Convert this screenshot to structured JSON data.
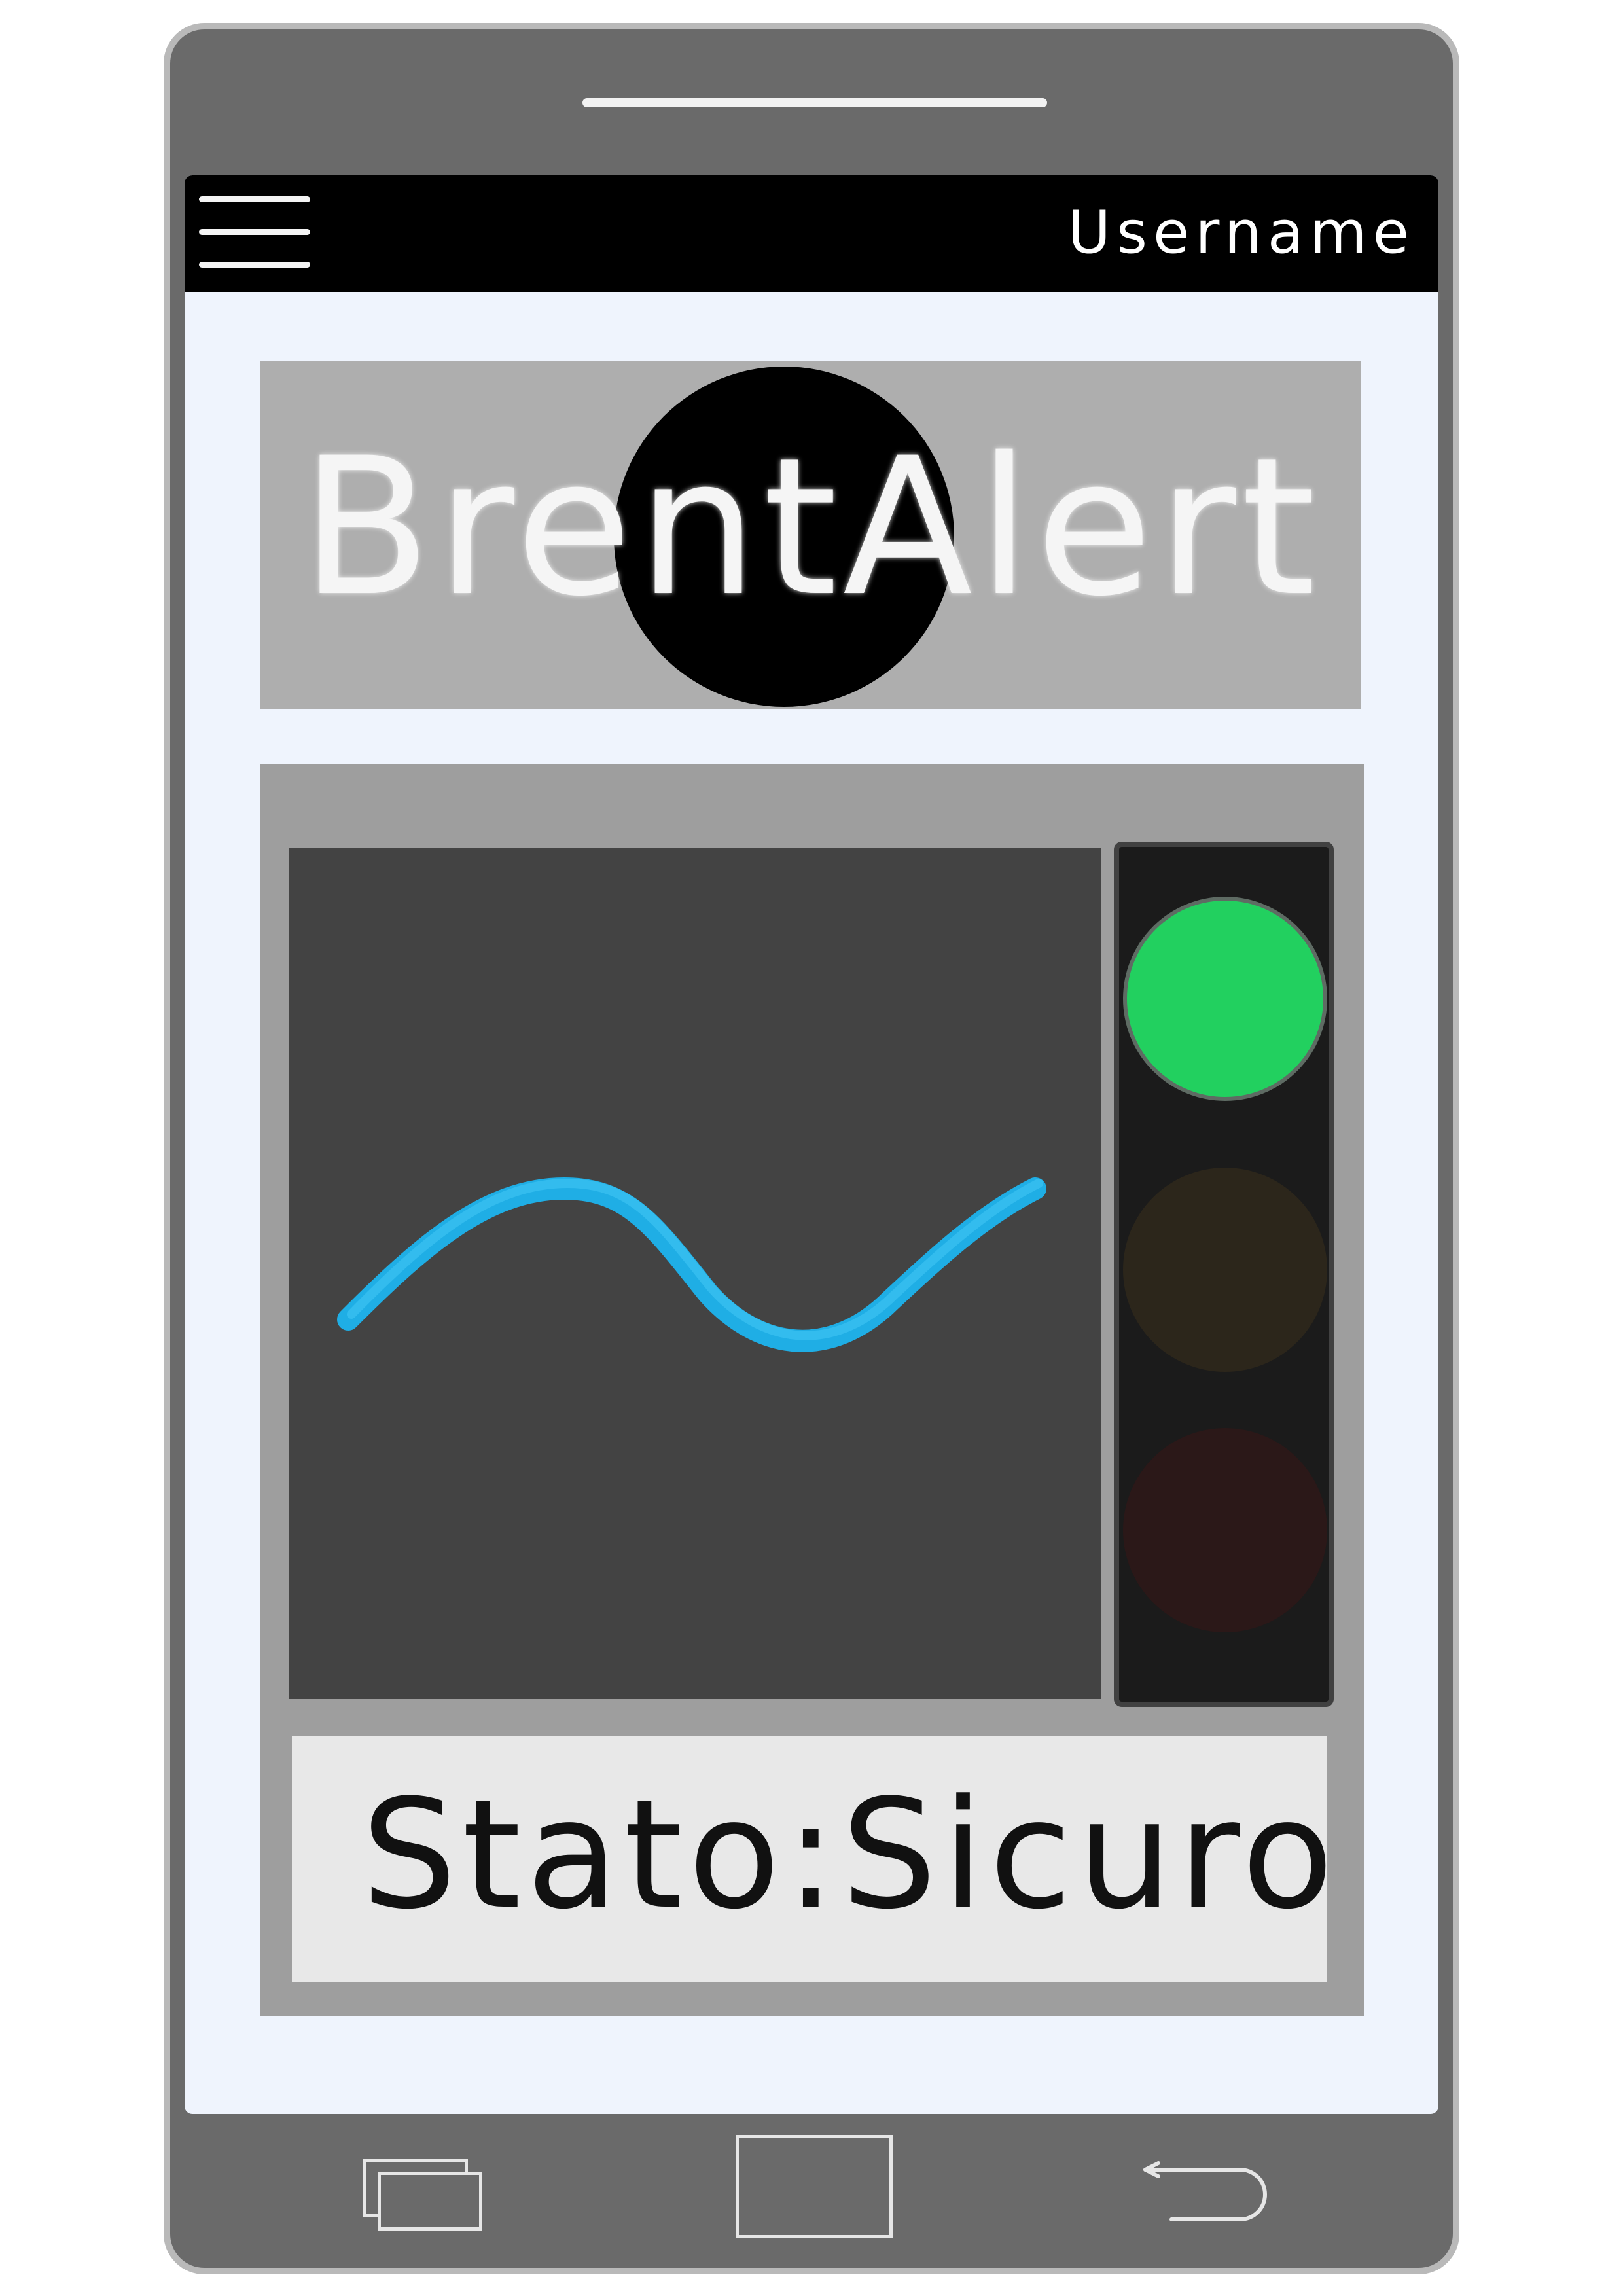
{
  "header": {
    "menu_icon": "hamburger-menu-icon",
    "username": "Username"
  },
  "logo": {
    "text": "BrentAlert"
  },
  "monitor": {
    "graph": {
      "type": "line",
      "color": "#1db4ee",
      "background": "#434343"
    },
    "traffic_light": {
      "active": "green",
      "colors": {
        "green": "#22d05f",
        "yellow_off": "#2c261b",
        "red_off": "#2b1818"
      }
    },
    "status_text": "Stato:Sicuro"
  },
  "navbar": {
    "icons": [
      "recent-apps-icon",
      "home-icon",
      "back-icon"
    ]
  }
}
